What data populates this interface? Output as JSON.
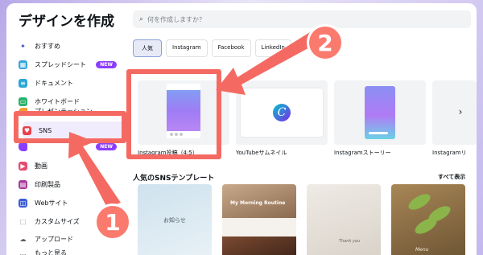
{
  "modal": {
    "title": "デザインを作成"
  },
  "sidebar": {
    "items": [
      {
        "label": "おすすめ",
        "icon": "sparkle-icon",
        "color": "#2d4dc2"
      },
      {
        "label": "スプレッドシート",
        "icon": "spreadsheet-icon",
        "color": "#3aa4dd",
        "badge": "NEW"
      },
      {
        "label": "ドキュメント",
        "icon": "document-icon",
        "color": "#2aa6d6"
      },
      {
        "label": "ホワイトボード",
        "icon": "whiteboard-icon",
        "color": "#2cb36b"
      },
      {
        "label": "プレゼンテーション",
        "icon": "presentation-icon",
        "color": "#f39c2b"
      },
      {
        "label": "SNS",
        "icon": "heart-icon",
        "color": "#e8404a"
      },
      {
        "label": "",
        "icon": "video-icon",
        "color": "#8b3dff",
        "badge": "NEW"
      },
      {
        "label": "動画",
        "icon": "video-play-icon",
        "color": "#e84a6f"
      },
      {
        "label": "印刷製品",
        "icon": "print-icon",
        "color": "#a9399b"
      },
      {
        "label": "Webサイト",
        "icon": "website-icon",
        "color": "#3a5bd6"
      },
      {
        "label": "カスタムサイズ",
        "icon": "custom-size-icon",
        "color": "#555b66"
      },
      {
        "label": "アップロード",
        "icon": "upload-icon",
        "color": "#555b66"
      },
      {
        "label": "もっと見る",
        "icon": "more-icon",
        "color": "#555b66"
      }
    ]
  },
  "search": {
    "placeholder": "何を作成しますか？"
  },
  "tabs": [
    "人気",
    "Instagram",
    "Facebook",
    "LinkedIn"
  ],
  "cards": [
    {
      "label": "Instagram投稿（4:5）"
    },
    {
      "label": "YouTubeサムネイル"
    },
    {
      "label": "Instagramストーリー"
    },
    {
      "label": "Instagramリ"
    }
  ],
  "templates_section": {
    "title": "人気のSNSテンプレート",
    "see_all": "すべて表示",
    "items": [
      {
        "text": "お知らせ"
      },
      {
        "text": "My Morning Routine"
      },
      {
        "text": "Thank you"
      },
      {
        "text": "Menu"
      }
    ]
  },
  "annotations": {
    "step1": "1",
    "step2": "2",
    "color": "#f46a63"
  }
}
